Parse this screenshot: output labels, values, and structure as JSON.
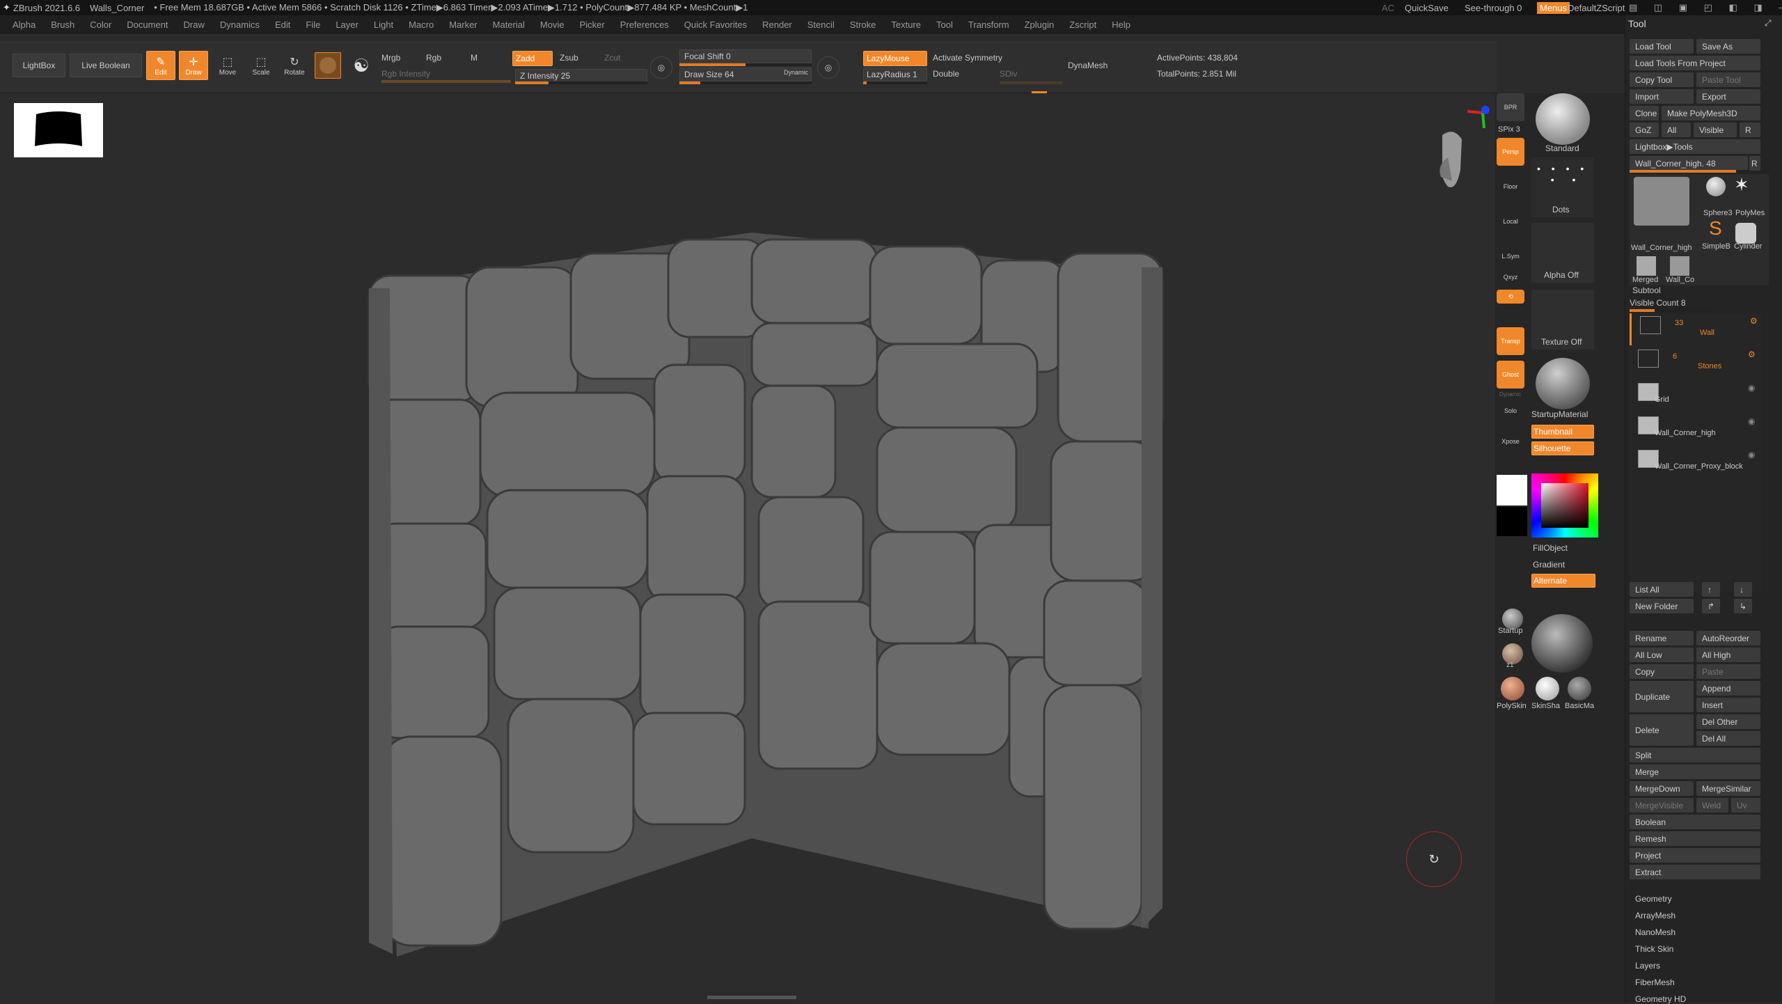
{
  "titlebar": {
    "app": "ZBrush 2021.6.6",
    "doc": "Walls_Corner",
    "stats": "• Free Mem 18.687GB • Active Mem 5866 • Scratch Disk 1126 • ZTime▶6.863 Timer▶2.093 ATime▶1.712 • PolyCount▶877.484 KP • MeshCount▶1",
    "ac": "AC",
    "quicksave": "QuickSave",
    "seethrough": "See-through 0",
    "menus": "Menus",
    "script": "DefaultZScript"
  },
  "menu": [
    "Alpha",
    "Brush",
    "Color",
    "Document",
    "Draw",
    "Dynamics",
    "Edit",
    "File",
    "Layer",
    "Light",
    "Macro",
    "Marker",
    "Material",
    "Movie",
    "Picker",
    "Preferences",
    "Quick Favorites",
    "Render",
    "Stencil",
    "Stroke",
    "Texture",
    "Tool",
    "Transform",
    "Zplugin",
    "Zscript",
    "Help"
  ],
  "top": {
    "lightbox": "LightBox",
    "live_boolean": "Live Boolean",
    "edit": "Edit",
    "draw": "Draw",
    "move": "Move",
    "scale": "Scale",
    "rotate": "Rotate",
    "mrgb": "Mrgb",
    "rgb": "Rgb",
    "m": "M",
    "rgb_intensity": "Rgb Intensity",
    "zadd": "Zadd",
    "zsub": "Zsub",
    "zcut": "Zcut",
    "z_intensity": "Z Intensity 25",
    "focal_shift": "Focal Shift 0",
    "draw_size": "Draw Size 64",
    "dynamic": "Dynamic",
    "lazymouse": "LazyMouse",
    "lazyradius": "LazyRadius 1",
    "activate_symmetry": "Activate Symmetry",
    "double": "Double",
    "sdiv": "SDiv",
    "dynamesh": "DynaMesh",
    "active_points": "ActivePoints: 438,804",
    "total_points": "TotalPoints: 2.851 Mil",
    "z_intensity_value": 25,
    "draw_size_value": 64
  },
  "shelf": {
    "bpr": "BPR",
    "spix": "SPix 3",
    "persp": "Persp",
    "floor": "Floor",
    "local": "Local",
    "lsym": "L.Sym",
    "xyz": "Qxyz",
    "transp": "Transp",
    "ghost": "Ghost",
    "dynamic": "Dynamic",
    "solo": "Solo",
    "xpose": "Xpose",
    "brush": "Standard",
    "stroke": "Dots",
    "alpha": "Alpha Off",
    "texture": "Texture Off",
    "material": "StartupMaterial",
    "thumbnail": "Thumbnail",
    "silhouette": "Silhouette",
    "fillobject": "FillObject",
    "gradient": "Gradient",
    "alternate": "Alternate",
    "mat1": "Startup",
    "mat2": "z1",
    "mat3": "PolySkin",
    "mat4": "SkinSha",
    "mat5": "BasicMa"
  },
  "tool": {
    "title": "Tool",
    "load_tool": "Load Tool",
    "save_as": "Save As",
    "load_from_project": "Load Tools From Project",
    "copy_tool": "Copy Tool",
    "paste_tool": "Paste Tool",
    "import": "Import",
    "export": "Export",
    "clone": "Clone",
    "make_polymesh": "Make PolyMesh3D",
    "goz": "GoZ",
    "all": "All",
    "visible": "Visible",
    "r": "R",
    "lightbox_tools": "Lightbox▶Tools",
    "current_tool": "Wall_Corner_high. 48",
    "thumbs": [
      "Wall_Corner_high",
      "Sphere3",
      "PolyMes",
      "SimpleB",
      "Cylinder",
      "Merged",
      "Wall_Co"
    ],
    "subtool": "Subtool",
    "visible_count": "Visible Count 8",
    "subtools": [
      {
        "count": "33",
        "name": "Wall"
      },
      {
        "count": "6",
        "name": "Stones"
      },
      {
        "count": "",
        "name": "Grid"
      },
      {
        "count": "",
        "name": "Wall_Corner_high"
      },
      {
        "count": "",
        "name": "Wall_Corner_Proxy_block"
      }
    ],
    "list_all": "List All",
    "new_folder": "New Folder",
    "rename": "Rename",
    "autoreorder": "AutoReorder",
    "all_low": "All Low",
    "all_high": "All High",
    "copy": "Copy",
    "paste": "Paste",
    "duplicate": "Duplicate",
    "append": "Append",
    "insert": "Insert",
    "delete": "Delete",
    "del_other": "Del Other",
    "del_all": "Del All",
    "split": "Split",
    "merge": "Merge",
    "mergedown": "MergeDown",
    "mergesimilar": "MergeSimilar",
    "mergevisible": "MergeVisible",
    "weld": "Weld",
    "uv": "Uv",
    "boolean": "Boolean",
    "remesh": "Remesh",
    "project": "Project",
    "extract": "Extract",
    "sections": [
      "Geometry",
      "ArrayMesh",
      "NanoMesh",
      "Thick Skin",
      "Layers",
      "FiberMesh",
      "Geometry HD"
    ]
  },
  "colors": {
    "accent": "#f0872a",
    "bg": "#2c2c2c",
    "panel": "#242424"
  }
}
